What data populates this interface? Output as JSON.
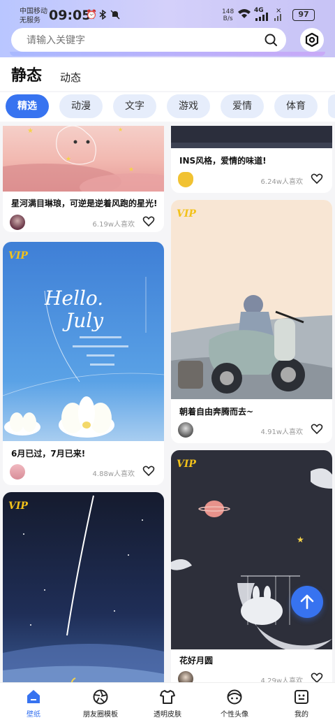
{
  "status_bar": {
    "carrier_line1": "中国移动",
    "carrier_line2": "无服务",
    "time": "09:05",
    "net_speed_value": "148",
    "net_speed_unit": "B/s",
    "network": "4G",
    "battery": "97"
  },
  "search": {
    "placeholder": "请输入关键字"
  },
  "top_tabs": {
    "static": "静态",
    "dynamic": "动态"
  },
  "categories": [
    "精选",
    "动漫",
    "文字",
    "游戏",
    "爱情",
    "体育"
  ],
  "cards": [
    {
      "title": "星河满目琳琅，可逆是逆着风跑的星光!",
      "likes": "6.19w人喜欢"
    },
    {
      "title": "INS风格，爱情的味道!",
      "likes": "6.24w人喜欢"
    },
    {
      "title": "6月已过，7月已来!",
      "likes": "4.88w人喜欢",
      "badge": "VIP",
      "art_text1": "Hello.",
      "art_text2": "July"
    },
    {
      "title": "朝着自由奔腾而去~",
      "likes": "4.91w人喜欢",
      "badge": "VIP"
    },
    {
      "title": "",
      "likes": "",
      "badge": "VIP"
    },
    {
      "title": "花好月圆",
      "likes": "4.29w人喜欢",
      "badge": "VIP"
    }
  ],
  "bottom_nav": [
    "壁纸",
    "朋友圈模板",
    "透明皮肤",
    "个性头像",
    "我的"
  ],
  "colors": {
    "accent": "#3773f0",
    "chip_bg": "#e6edfb",
    "vip": "#f2c21a"
  }
}
